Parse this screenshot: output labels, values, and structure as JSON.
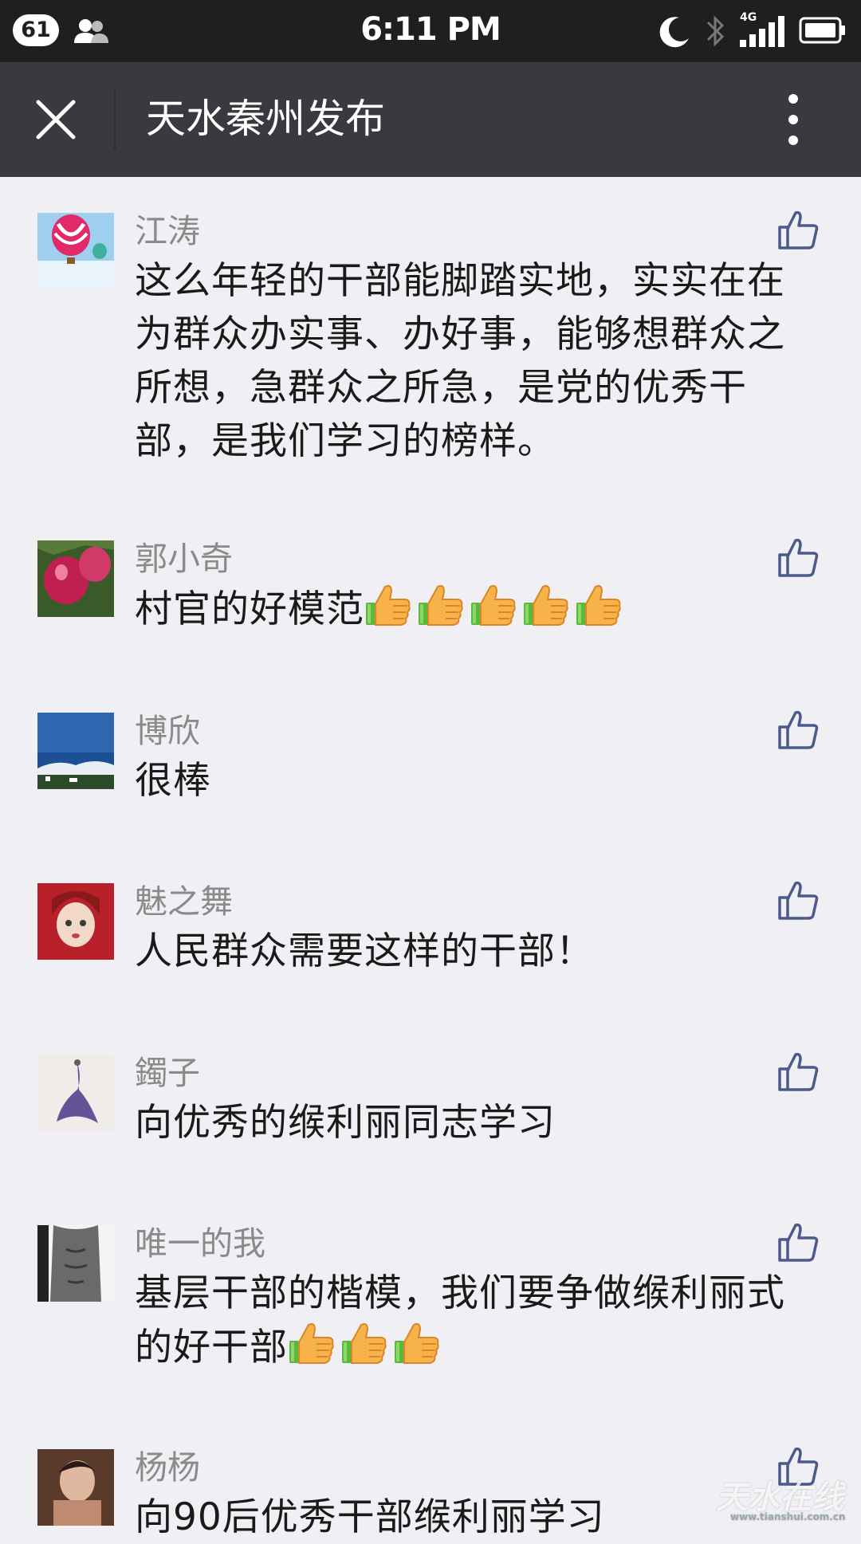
{
  "status_bar": {
    "notification_count": "61",
    "time": "6:11 PM",
    "network": "4G"
  },
  "header": {
    "title": "天水秦州发布"
  },
  "comments": [
    {
      "nickname": "江涛",
      "text": "这么年轻的干部能脚踏实地，实实在在为群众办实事、办好事，能够想群众之所想，急群众之所急，是党的优秀干部，是我们学习的榜样。",
      "emoji_count": 0
    },
    {
      "nickname": "郭小奇",
      "text": "村官的好模范",
      "emoji_count": 5
    },
    {
      "nickname": "博欣",
      "text": "很棒",
      "emoji_count": 0
    },
    {
      "nickname": "魅之舞",
      "text": "人民群众需要这样的干部！",
      "emoji_count": 0
    },
    {
      "nickname": "鐲子",
      "text": "向优秀的缑利丽同志学习",
      "emoji_count": 0
    },
    {
      "nickname": "唯一的我",
      "text": "基层干部的楷模，我们要争做缑利丽式的好干部",
      "emoji_count": 3
    },
    {
      "nickname": "杨杨",
      "text": "向90后优秀干部缑利丽学习",
      "emoji_count": 0
    }
  ],
  "watermark": {
    "text": "天水在线",
    "url": "www.tianshui.com.cn"
  },
  "colors": {
    "status_bar_bg": "#1f1f21",
    "title_bar_bg": "#393a3f",
    "page_bg": "#efeff4",
    "like_icon": "#4a5a8a",
    "nickname": "#8a8a8a"
  },
  "icons": {
    "close": "close-icon",
    "more": "more-vertical-icon",
    "like": "thumbs-up-icon",
    "emoji": "thumbs-up-emoji"
  }
}
